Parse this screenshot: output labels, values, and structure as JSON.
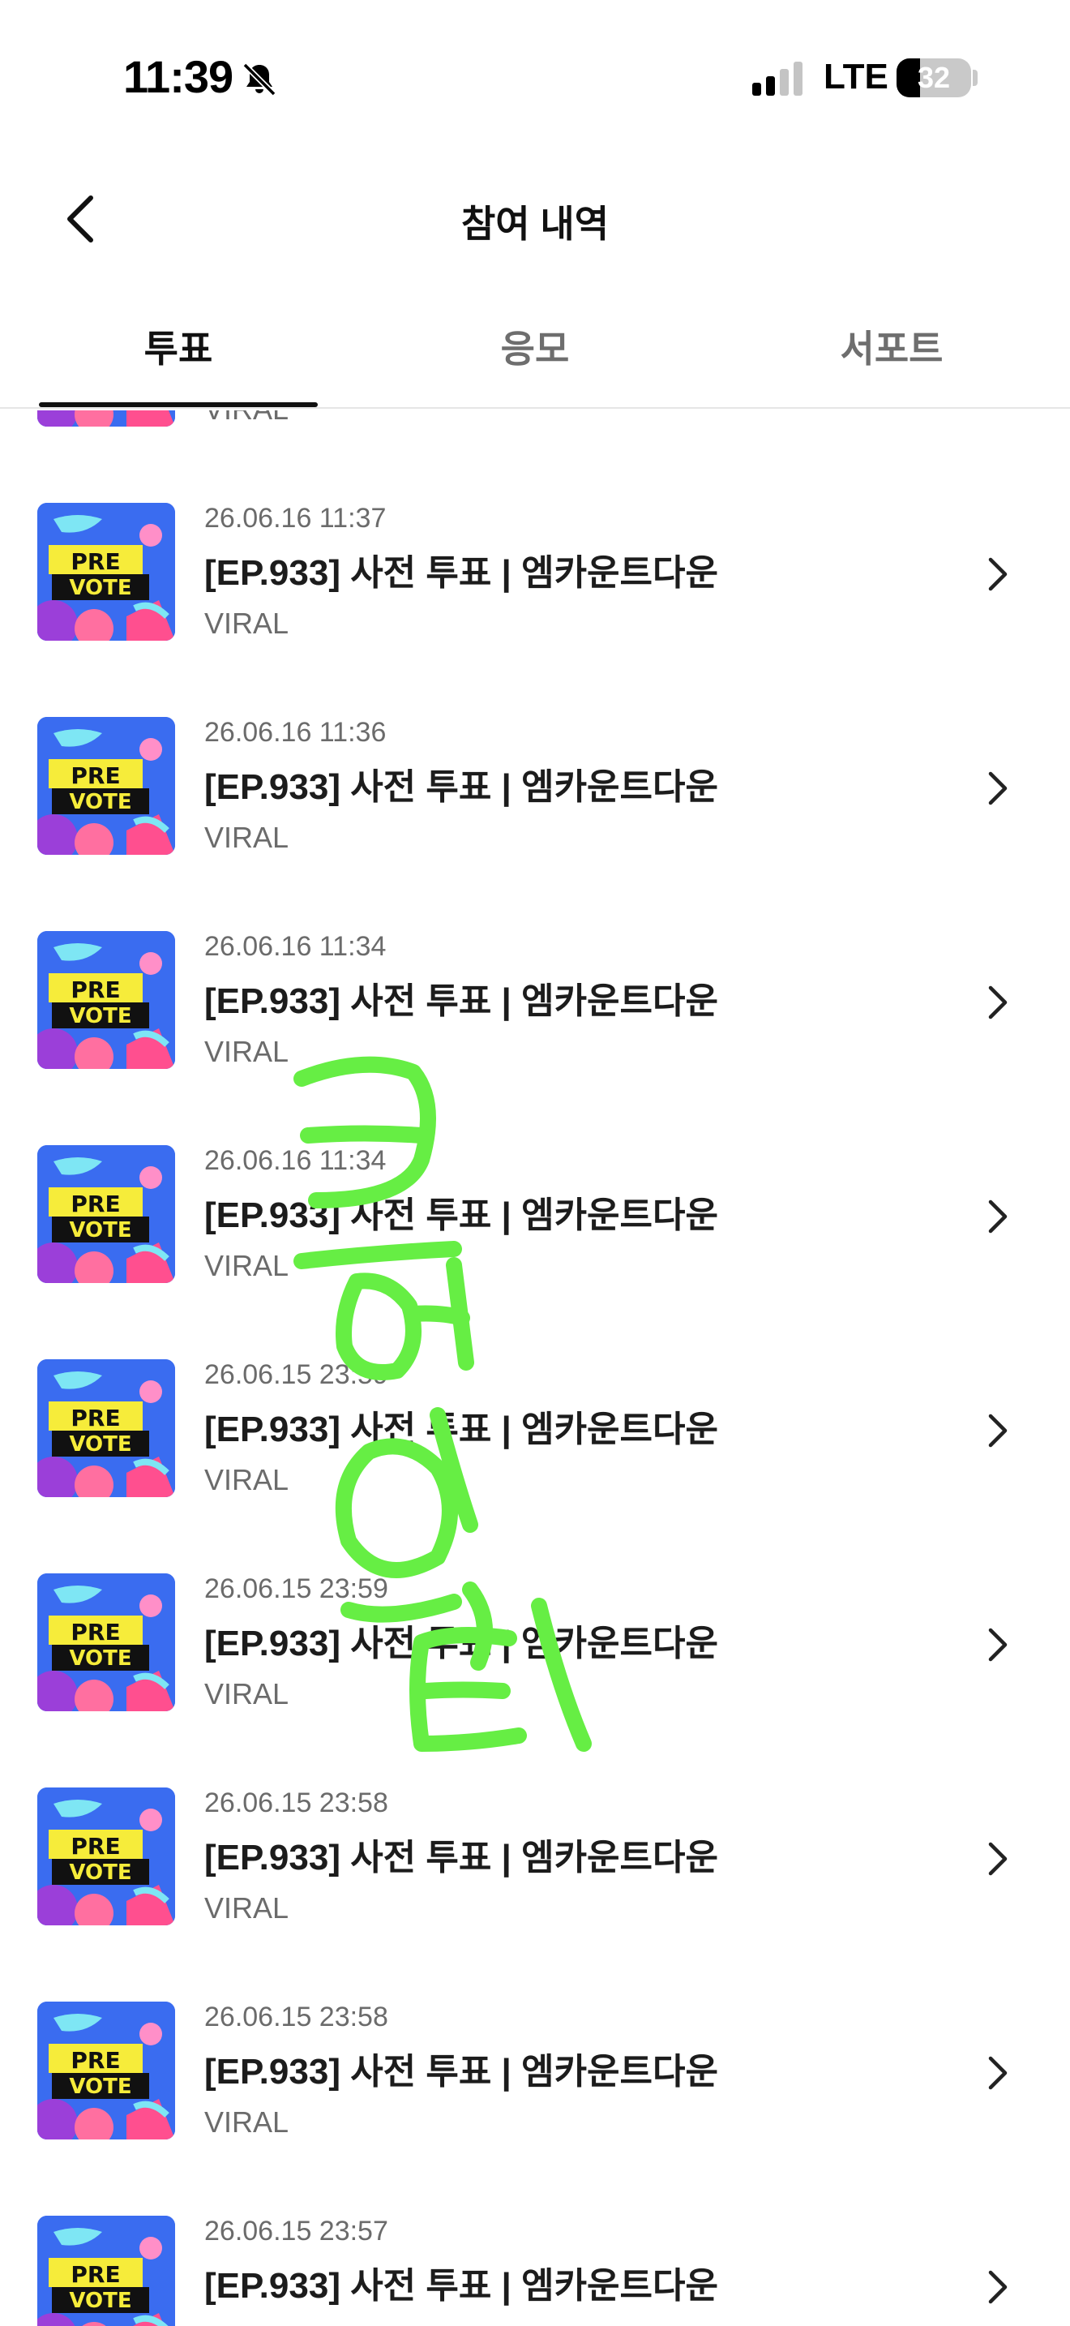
{
  "status_bar": {
    "time": "11:39",
    "network": "LTE",
    "battery": "32",
    "battery_level": 0.32,
    "icons": [
      "bell-slash-icon",
      "signal-icon"
    ]
  },
  "header": {
    "title": "참여 내역",
    "back_icon": "chevron-left-icon"
  },
  "tabs": [
    {
      "label": "투표",
      "active": true
    },
    {
      "label": "응모",
      "active": false
    },
    {
      "label": "서포트",
      "active": false
    }
  ],
  "partial_top_item": {
    "source": "VIRAL"
  },
  "list": [
    {
      "date": "26.06.16 11:37",
      "title": "[EP.933] 사전 투표 | 엠카운트다운",
      "source": "VIRAL",
      "thumb_line1": "PRE",
      "thumb_line2": "VOTE"
    },
    {
      "date": "26.06.16 11:36",
      "title": "[EP.933] 사전 투표 | 엠카운트다운",
      "source": "VIRAL",
      "thumb_line1": "PRE",
      "thumb_line2": "VOTE"
    },
    {
      "date": "26.06.16 11:34",
      "title": "[EP.933] 사전 투표 | 엠카운트다운",
      "source": "VIRAL",
      "thumb_line1": "PRE",
      "thumb_line2": "VOTE"
    },
    {
      "date": "26.06.16 11:34",
      "title": "[EP.933] 사전 투표 | 엠카운트다운",
      "source": "VIRAL",
      "thumb_line1": "PRE",
      "thumb_line2": "VOTE"
    },
    {
      "date": "26.06.15 23:59",
      "title": "[EP.933] 사전 투표 | 엠카운트다운",
      "source": "VIRAL",
      "thumb_line1": "PRE",
      "thumb_line2": "VOTE"
    },
    {
      "date": "26.06.15 23:59",
      "title": "[EP.933] 사전 투표 | 엠카운트다운",
      "source": "VIRAL",
      "thumb_line1": "PRE",
      "thumb_line2": "VOTE"
    },
    {
      "date": "26.06.15 23:58",
      "title": "[EP.933] 사전 투표 | 엠카운트다운",
      "source": "VIRAL",
      "thumb_line1": "PRE",
      "thumb_line2": "VOTE"
    },
    {
      "date": "26.06.15 23:58",
      "title": "[EP.933] 사전 투표 | 엠카운트다운",
      "source": "VIRAL",
      "thumb_line1": "PRE",
      "thumb_line2": "VOTE"
    },
    {
      "date": "26.06.15 23:57",
      "title": "[EP.933] 사전 투표 | 엠카운트다운",
      "source": "VIRAL",
      "thumb_line1": "PRE",
      "thumb_line2": "VOTE"
    }
  ],
  "overlay": {
    "handwriting": "큐어 인 티",
    "color": "#66ee44"
  },
  "colors": {
    "text_primary": "#1c1c1c",
    "text_secondary": "#6b6b6b",
    "thumb_blue": "#3a6cf0",
    "thumb_yellow": "#f6ec3a"
  }
}
